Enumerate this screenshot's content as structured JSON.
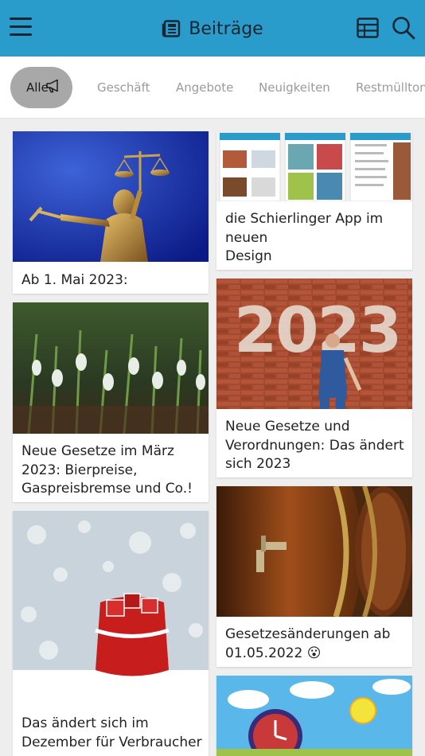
{
  "header": {
    "title": "Beiträge",
    "icons": [
      "menu-icon",
      "newspaper-icon",
      "grid-view-icon",
      "search-icon"
    ],
    "bar_color": "#2a9ccc"
  },
  "tabs": [
    {
      "label": "Alle",
      "active": true,
      "icon": "megaphone-icon"
    },
    {
      "label": "Geschäft"
    },
    {
      "label": "Angebote"
    },
    {
      "label": "Neuigkeiten"
    },
    {
      "label": "Restmülltonn"
    }
  ],
  "posts": {
    "left": [
      {
        "caption": "Ab 1. Mai 2023:"
      },
      {
        "caption": "Neue Gesetze im März 2023: Bierpreise, Gaspreisbremse und Co.!"
      },
      {
        "caption": "Das ändert sich im Dezember für Verbraucher"
      }
    ],
    "right": [
      {
        "caption": "die Schierlinger App im\nneuen\nDesign"
      },
      {
        "caption": "Neue Gesetze und Verordnungen: Das ändert sich 2023"
      },
      {
        "caption": "Gesetzesänderungen ab 01.05.2022 😮"
      },
      {
        "caption": ""
      }
    ]
  }
}
